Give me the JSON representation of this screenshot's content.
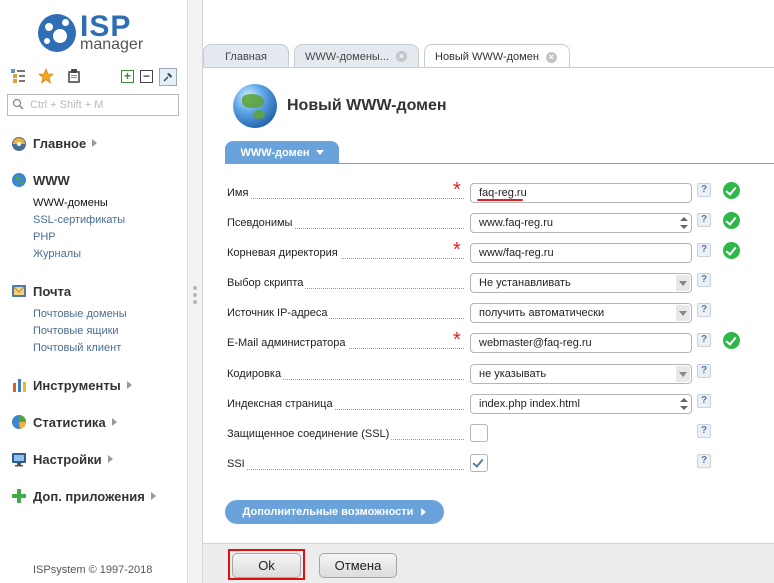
{
  "brand": {
    "name": "ISP",
    "sub": "manager"
  },
  "search": {
    "placeholder": "Ctrl + Shift + M"
  },
  "menu": [
    {
      "label": "Главное",
      "items": []
    },
    {
      "label": "WWW",
      "items": [
        "WWW-домены",
        "SSL-сертификаты",
        "PHP",
        "Журналы"
      ]
    },
    {
      "label": "Почта",
      "items": [
        "Почтовые домены",
        "Почтовые ящики",
        "Почтовый клиент"
      ]
    },
    {
      "label": "Инструменты",
      "items": []
    },
    {
      "label": "Статистика",
      "items": []
    },
    {
      "label": "Настройки",
      "items": []
    },
    {
      "label": "Доп. приложения",
      "items": []
    }
  ],
  "copyright": "ISPsystem © 1997-2018",
  "tabs": [
    {
      "label": "Главная",
      "closable": false
    },
    {
      "label": "WWW-домены...",
      "closable": true
    },
    {
      "label": "Новый WWW-домен",
      "closable": true,
      "active": true
    }
  ],
  "page": {
    "title": "Новый WWW-домен",
    "form_tab": "WWW-домен",
    "fields": [
      {
        "label": "Имя",
        "value": "faq-reg.ru",
        "required": true,
        "kind": "text",
        "valid": true
      },
      {
        "label": "Псевдонимы",
        "value": "www.faq-reg.ru",
        "required": false,
        "kind": "spin",
        "valid": true
      },
      {
        "label": "Корневая директория",
        "value": "www/faq-reg.ru",
        "required": true,
        "kind": "text",
        "valid": true
      },
      {
        "label": "Выбор скрипта",
        "value": "Не устанавливать",
        "required": false,
        "kind": "select",
        "valid": false
      },
      {
        "label": "Источник IP-адреса",
        "value": "получить автоматически",
        "required": false,
        "kind": "select",
        "valid": false
      },
      {
        "label": "E-Mail администратора",
        "value": "webmaster@faq-reg.ru",
        "required": true,
        "kind": "text",
        "valid": true
      },
      {
        "label": "Кодировка",
        "value": "не указывать",
        "required": false,
        "kind": "select",
        "valid": false
      },
      {
        "label": "Индексная страница",
        "value": "index.php index.html",
        "required": false,
        "kind": "spin",
        "valid": false
      },
      {
        "label": "Защищенное соединение (SSL)",
        "value": "",
        "required": false,
        "kind": "checkbox",
        "checked": false,
        "valid": false
      },
      {
        "label": "SSI",
        "value": "",
        "required": false,
        "kind": "checkbox",
        "checked": true,
        "valid": false
      }
    ],
    "help_symbol": "?",
    "more_button": "Дополнительные возможности",
    "ok_button": "Ok",
    "cancel_button": "Отмена"
  },
  "colors": {
    "accent": "#6aa3dc",
    "required": "#e02020",
    "valid": "#2fb84a",
    "brand": "#2f6db5"
  }
}
